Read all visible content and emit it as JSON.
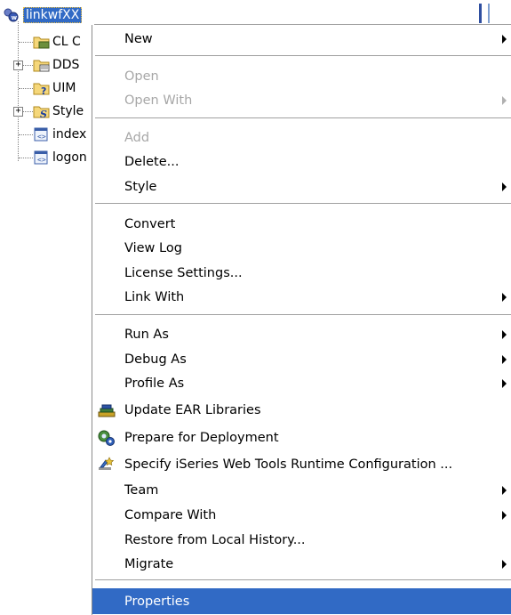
{
  "tree": {
    "root": {
      "label": "linkwfXX"
    },
    "children": [
      {
        "label": "CL C",
        "icon": "folder-icon",
        "expandable": false
      },
      {
        "label": "DDS",
        "icon": "folder-icon",
        "expandable": true
      },
      {
        "label": "UIM",
        "icon": "folder-question-icon",
        "expandable": false
      },
      {
        "label": "Style",
        "icon": "folder-style-icon",
        "expandable": true
      },
      {
        "label": "index",
        "icon": "html-file-icon",
        "expandable": false
      },
      {
        "label": "logon",
        "icon": "html-file-icon",
        "expandable": false
      }
    ]
  },
  "menu": {
    "items": [
      {
        "label": "New",
        "submenu": true,
        "enabled": true
      },
      {
        "label": "Open",
        "submenu": false,
        "enabled": false
      },
      {
        "label": "Open With",
        "submenu": true,
        "enabled": false
      },
      {
        "label": "Add",
        "submenu": false,
        "enabled": false
      },
      {
        "label": "Delete...",
        "submenu": false,
        "enabled": true
      },
      {
        "label": "Style",
        "submenu": true,
        "enabled": true
      },
      {
        "label": "Convert",
        "submenu": false,
        "enabled": true
      },
      {
        "label": "View Log",
        "submenu": false,
        "enabled": true
      },
      {
        "label": "License Settings...",
        "submenu": false,
        "enabled": true
      },
      {
        "label": "Link With",
        "submenu": true,
        "enabled": true
      },
      {
        "label": "Run As",
        "submenu": true,
        "enabled": true
      },
      {
        "label": "Debug As",
        "submenu": true,
        "enabled": true
      },
      {
        "label": "Profile As",
        "submenu": true,
        "enabled": true
      },
      {
        "label": "Update EAR Libraries",
        "submenu": false,
        "enabled": true,
        "icon": "ear-libraries-icon"
      },
      {
        "label": "Prepare for Deployment",
        "submenu": false,
        "enabled": true,
        "icon": "deployment-icon"
      },
      {
        "label": "Specify iSeries Web Tools Runtime Configuration ...",
        "submenu": false,
        "enabled": true,
        "icon": "runtime-config-icon"
      },
      {
        "label": "Team",
        "submenu": true,
        "enabled": true
      },
      {
        "label": "Compare With",
        "submenu": true,
        "enabled": true
      },
      {
        "label": "Restore from Local History...",
        "submenu": false,
        "enabled": true
      },
      {
        "label": "Migrate",
        "submenu": true,
        "enabled": true
      },
      {
        "label": "Properties",
        "submenu": false,
        "enabled": true,
        "selected": true
      }
    ]
  },
  "colors": {
    "selection": "#316ac5",
    "disabled_text": "#a7a7a7",
    "separator": "#a0a0a0"
  }
}
